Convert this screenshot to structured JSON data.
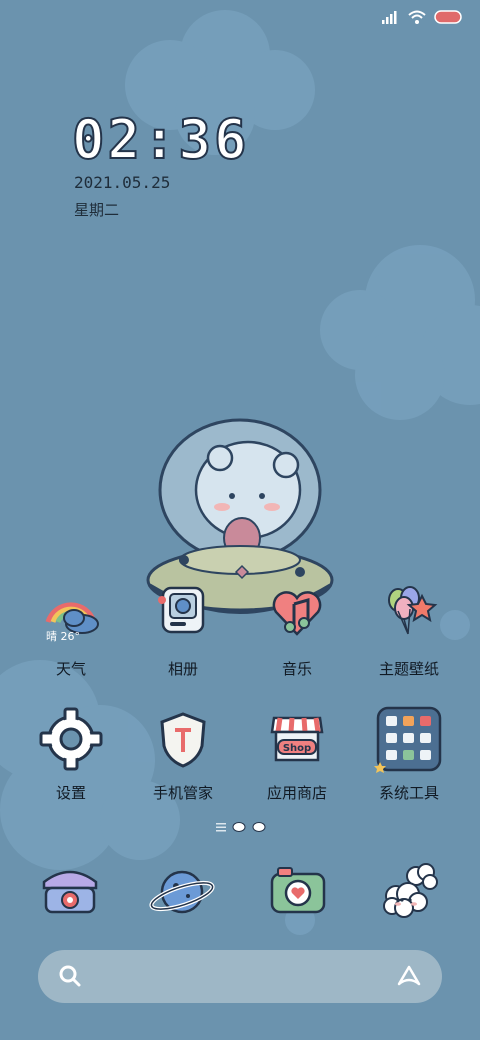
{
  "status_bar": {
    "icons": [
      "signal-icon",
      "wifi-icon",
      "battery-icon"
    ],
    "battery_color": "#e06a6a"
  },
  "lockclock": {
    "time": "02:36",
    "date": "2021.05.25",
    "weekday": "星期二"
  },
  "weather": {
    "summary": "晴 26°"
  },
  "apps": {
    "row1": [
      {
        "label": "天气",
        "icon": "rainbow-cloud-icon"
      },
      {
        "label": "相册",
        "icon": "camera-gallery-icon"
      },
      {
        "label": "音乐",
        "icon": "heart-note-icon"
      },
      {
        "label": "主题壁纸",
        "icon": "balloons-icon"
      }
    ],
    "row2": [
      {
        "label": "设置",
        "icon": "gear-icon"
      },
      {
        "label": "手机管家",
        "icon": "shield-icon"
      },
      {
        "label": "应用商店",
        "icon": "shop-icon"
      },
      {
        "label": "系统工具",
        "icon": "folder-icon"
      }
    ]
  },
  "shop_sign": "Shop",
  "dock": {
    "items": [
      "phone-icon",
      "planet-icon",
      "camera-icon",
      "cloud-chat-icon"
    ]
  },
  "search_bar": {
    "left_icon": "search-icon",
    "right_icon": "assistant-icon"
  },
  "colors": {
    "background": "#6b93ae",
    "cloud": "#7aa2bd",
    "outline": "#24344a"
  }
}
